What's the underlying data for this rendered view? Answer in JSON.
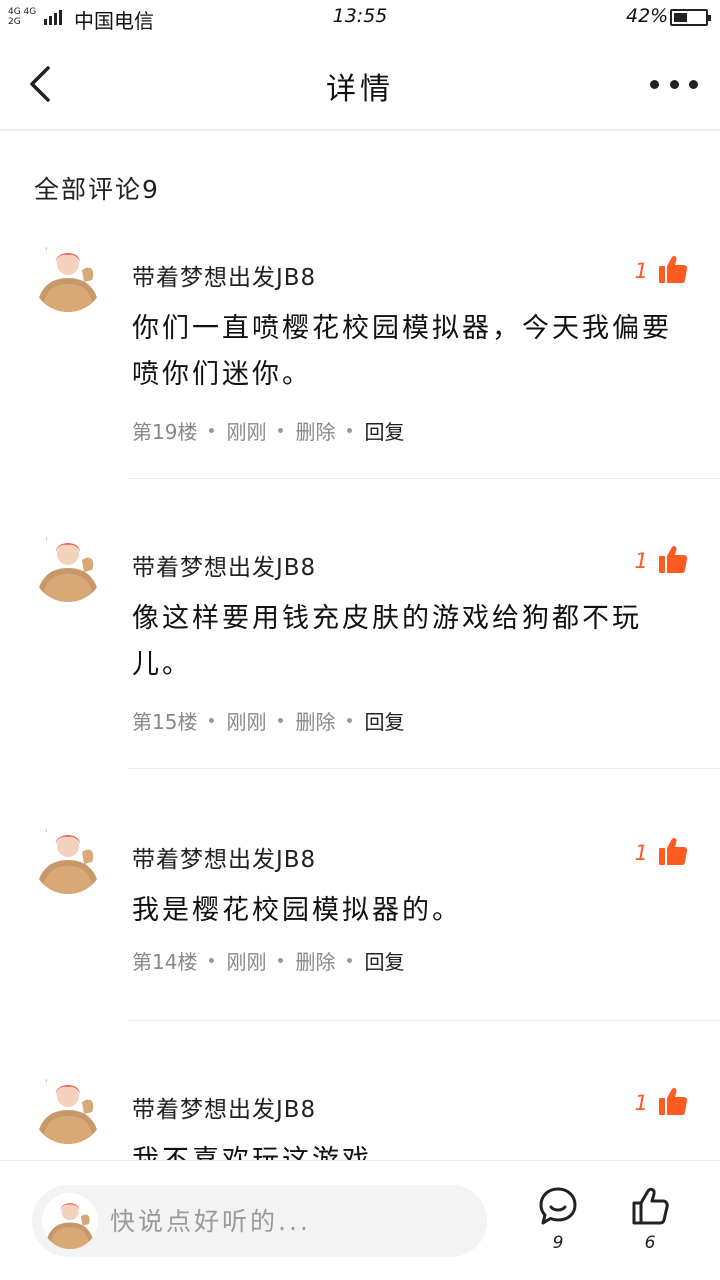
{
  "status_bar": {
    "network": "4G 4G",
    "network_sub": "2G",
    "carrier": "中国电信",
    "time": "13:55",
    "battery_percent": "42%",
    "battery_level": 0.42
  },
  "nav": {
    "title": "详情",
    "back_icon": "chevron-left-icon",
    "more_icon": "more-dots-icon"
  },
  "comments_section": {
    "title": "全部评论9"
  },
  "comments": [
    {
      "username": "带着梦想出发JB8",
      "likes": "1",
      "text": "你们一直喷樱花校园模拟器，今天我偏要喷你们迷你。",
      "floor": "第19楼",
      "time": "刚刚",
      "delete": "删除",
      "reply": "回复"
    },
    {
      "username": "带着梦想出发JB8",
      "likes": "1",
      "text": "像这样要用钱充皮肤的游戏给狗都不玩儿。",
      "floor": "第15楼",
      "time": "刚刚",
      "delete": "删除",
      "reply": "回复"
    },
    {
      "username": "带着梦想出发JB8",
      "likes": "1",
      "text": "我是樱花校园模拟器的。",
      "floor": "第14楼",
      "time": "刚刚",
      "delete": "删除",
      "reply": "回复"
    },
    {
      "username": "带着梦想出发JB8",
      "likes": "1",
      "text": "我不喜欢玩这游戏",
      "floor": "",
      "time": "",
      "delete": "",
      "reply": ""
    }
  ],
  "bottom_bar": {
    "input_placeholder": "快说点好听的...",
    "comment_count": "9",
    "like_count": "6",
    "comment_icon": "comment-bubble-icon",
    "like_icon": "thumbs-up-icon"
  },
  "colors": {
    "accent": "#ff5a1f",
    "divider": "#ececec",
    "input_bg": "#f3f3f3"
  }
}
